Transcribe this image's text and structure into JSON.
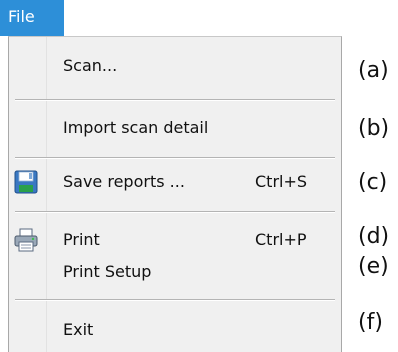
{
  "menu_bar": {
    "file_label": "File"
  },
  "menu": {
    "items": [
      {
        "label": "Scan...",
        "shortcut": ""
      },
      {
        "label": "Import scan detail",
        "shortcut": ""
      },
      {
        "label": "Save reports ...",
        "shortcut": "Ctrl+S",
        "icon": "floppy-disk-icon"
      },
      {
        "label": "Print",
        "shortcut": "Ctrl+P",
        "icon": "printer-icon"
      },
      {
        "label": "Print Setup",
        "shortcut": ""
      },
      {
        "label": "Exit",
        "shortcut": ""
      }
    ]
  },
  "annotations": [
    "(a)",
    "(b)",
    "(c)",
    "(d)",
    "(e)",
    "(f)"
  ],
  "colors": {
    "file_tab_bg": "#2d8fd8",
    "menu_bg": "#f0f0f0"
  }
}
